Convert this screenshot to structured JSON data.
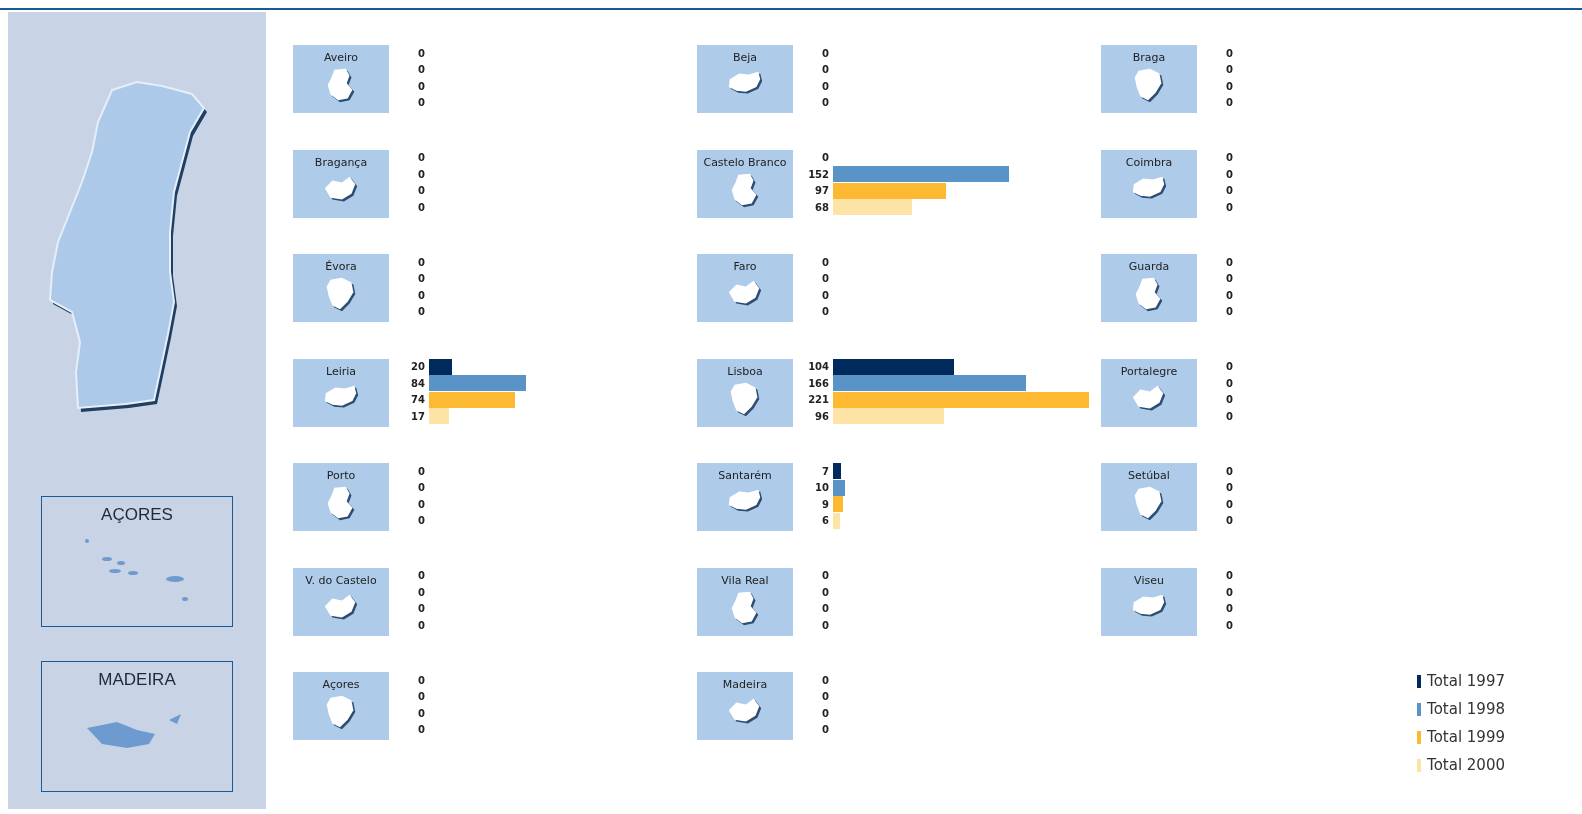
{
  "sidebar": {
    "insets": [
      {
        "label": "AÇORES",
        "kind": "islands"
      },
      {
        "label": "MADEIRA",
        "kind": "island"
      }
    ]
  },
  "districts": [
    {
      "name": "Aveiro",
      "values": [
        "0",
        "0",
        "0",
        "0"
      ]
    },
    {
      "name": "Beja",
      "values": [
        "0",
        "0",
        "0",
        "0"
      ]
    },
    {
      "name": "Braga",
      "values": [
        "0",
        "0",
        "0",
        "0"
      ]
    },
    {
      "name": "Bragança",
      "values": [
        "0",
        "0",
        "0",
        "0"
      ]
    },
    {
      "name": "Castelo Branco",
      "values": [
        "0",
        "152",
        "97",
        "68"
      ]
    },
    {
      "name": "Coimbra",
      "values": [
        "0",
        "0",
        "0",
        "0"
      ]
    },
    {
      "name": "Évora",
      "values": [
        "0",
        "0",
        "0",
        "0"
      ]
    },
    {
      "name": "Faro",
      "values": [
        "0",
        "0",
        "0",
        "0"
      ]
    },
    {
      "name": "Guarda",
      "values": [
        "0",
        "0",
        "0",
        "0"
      ]
    },
    {
      "name": "Leiria",
      "values": [
        "20",
        "84",
        "74",
        "17"
      ]
    },
    {
      "name": "Lisboa",
      "values": [
        "104",
        "166",
        "221",
        "96"
      ]
    },
    {
      "name": "Portalegre",
      "values": [
        "0",
        "0",
        "0",
        "0"
      ]
    },
    {
      "name": "Porto",
      "values": [
        "0",
        "0",
        "0",
        "0"
      ]
    },
    {
      "name": "Santarém",
      "values": [
        "7",
        "10",
        "9",
        "6"
      ]
    },
    {
      "name": "Setúbal",
      "values": [
        "0",
        "0",
        "0",
        "0"
      ]
    },
    {
      "name": "V. do Castelo",
      "values": [
        "0",
        "0",
        "0",
        "0"
      ]
    },
    {
      "name": "Vila Real",
      "values": [
        "0",
        "0",
        "0",
        "0"
      ]
    },
    {
      "name": "Viseu",
      "values": [
        "0",
        "0",
        "0",
        "0"
      ]
    },
    {
      "name": "Açores",
      "values": [
        "0",
        "0",
        "0",
        "0"
      ]
    },
    {
      "name": "Madeira",
      "values": [
        "0",
        "0",
        "0",
        "0"
      ]
    }
  ],
  "legend": [
    {
      "name": "Total 1997",
      "color": "#002a5c"
    },
    {
      "name": "Total 1998",
      "color": "#5a94c6"
    },
    {
      "name": "Total 1999",
      "color": "#fdb932"
    },
    {
      "name": "Total 2000",
      "color": "#fee3a6"
    }
  ]
}
